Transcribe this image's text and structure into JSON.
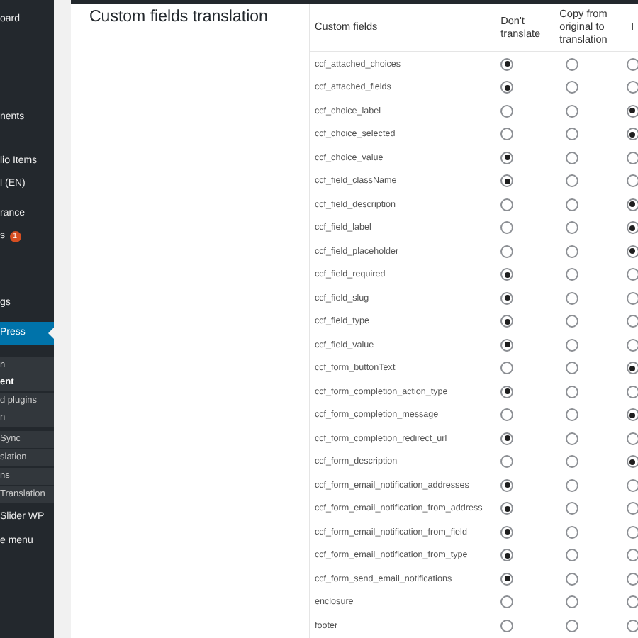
{
  "sidebar": {
    "items": [
      {
        "label": "oard",
        "kind": "item"
      },
      {
        "label": "nents",
        "kind": "item"
      },
      {
        "label": "lio Items",
        "kind": "item"
      },
      {
        "label": "l (EN)",
        "kind": "item"
      },
      {
        "label": "rance",
        "kind": "item"
      },
      {
        "label": "s",
        "kind": "item",
        "badge": "1"
      },
      {
        "label": "gs",
        "kind": "item"
      },
      {
        "label": "Press",
        "kind": "current"
      },
      {
        "label": "n",
        "kind": "sub"
      },
      {
        "label": "ent",
        "kind": "sub-current"
      },
      {
        "label": "d plugins",
        "kind": "sub"
      },
      {
        "label": "n",
        "kind": "sub"
      },
      {
        "label": "Sync",
        "kind": "sub"
      },
      {
        "label": "slation",
        "kind": "sub"
      },
      {
        "label": "ns",
        "kind": "sub"
      },
      {
        "label": "Translation",
        "kind": "sub"
      },
      {
        "label": "Slider WP",
        "kind": "item"
      },
      {
        "label": "e menu",
        "kind": "item"
      }
    ]
  },
  "section_title": "Custom fields translation",
  "table": {
    "columns": [
      "Custom fields",
      "Don't translate",
      "Copy from original to translation",
      "T"
    ],
    "rows": [
      {
        "name": "ccf_attached_choices",
        "options": [
          {
            "selected": true
          },
          {
            "selected": false
          },
          {
            "selected": false
          }
        ]
      },
      {
        "name": "ccf_attached_fields",
        "options": [
          {
            "selected": true
          },
          {
            "selected": false
          },
          {
            "selected": false
          }
        ]
      },
      {
        "name": "ccf_choice_label",
        "options": [
          {
            "selected": false
          },
          {
            "selected": false
          },
          {
            "selected": true
          }
        ]
      },
      {
        "name": "ccf_choice_selected",
        "options": [
          {
            "selected": false
          },
          {
            "selected": false
          },
          {
            "selected": true
          }
        ]
      },
      {
        "name": "ccf_choice_value",
        "options": [
          {
            "selected": true
          },
          {
            "selected": false
          },
          {
            "selected": false
          }
        ]
      },
      {
        "name": "ccf_field_className",
        "options": [
          {
            "selected": true
          },
          {
            "selected": false
          },
          {
            "selected": false
          }
        ]
      },
      {
        "name": "ccf_field_description",
        "options": [
          {
            "selected": false
          },
          {
            "selected": false
          },
          {
            "selected": true
          }
        ]
      },
      {
        "name": "ccf_field_label",
        "options": [
          {
            "selected": false
          },
          {
            "selected": false
          },
          {
            "selected": true
          }
        ]
      },
      {
        "name": "ccf_field_placeholder",
        "options": [
          {
            "selected": false
          },
          {
            "selected": false
          },
          {
            "selected": true
          }
        ]
      },
      {
        "name": "ccf_field_required",
        "options": [
          {
            "selected": true
          },
          {
            "selected": false
          },
          {
            "selected": false
          }
        ]
      },
      {
        "name": "ccf_field_slug",
        "options": [
          {
            "selected": true
          },
          {
            "selected": false
          },
          {
            "selected": false
          }
        ]
      },
      {
        "name": "ccf_field_type",
        "options": [
          {
            "selected": true
          },
          {
            "selected": false
          },
          {
            "selected": false
          }
        ]
      },
      {
        "name": "ccf_field_value",
        "options": [
          {
            "selected": true
          },
          {
            "selected": false
          },
          {
            "selected": false
          }
        ]
      },
      {
        "name": "ccf_form_buttonText",
        "options": [
          {
            "selected": false
          },
          {
            "selected": false
          },
          {
            "selected": true
          }
        ]
      },
      {
        "name": "ccf_form_completion_action_type",
        "options": [
          {
            "selected": true
          },
          {
            "selected": false
          },
          {
            "selected": false
          }
        ]
      },
      {
        "name": "ccf_form_completion_message",
        "options": [
          {
            "selected": false
          },
          {
            "selected": false
          },
          {
            "selected": true
          }
        ]
      },
      {
        "name": "ccf_form_completion_redirect_url",
        "options": [
          {
            "selected": true
          },
          {
            "selected": false
          },
          {
            "selected": false
          }
        ]
      },
      {
        "name": "ccf_form_description",
        "options": [
          {
            "selected": false
          },
          {
            "selected": false
          },
          {
            "selected": true
          }
        ]
      },
      {
        "name": "ccf_form_email_notification_addresses",
        "options": [
          {
            "selected": true
          },
          {
            "selected": false
          },
          {
            "selected": false
          }
        ]
      },
      {
        "name": "ccf_form_email_notification_from_address",
        "options": [
          {
            "selected": true
          },
          {
            "selected": false
          },
          {
            "selected": false
          }
        ]
      },
      {
        "name": "ccf_form_email_notification_from_field",
        "options": [
          {
            "selected": true
          },
          {
            "selected": false
          },
          {
            "selected": false
          }
        ]
      },
      {
        "name": "ccf_form_email_notification_from_type",
        "options": [
          {
            "selected": true
          },
          {
            "selected": false
          },
          {
            "selected": false
          }
        ]
      },
      {
        "name": "ccf_form_send_email_notifications",
        "options": [
          {
            "selected": true
          },
          {
            "selected": false
          },
          {
            "selected": false
          }
        ]
      },
      {
        "name": "enclosure",
        "options": [
          {
            "selected": false
          },
          {
            "selected": false
          },
          {
            "selected": false
          }
        ]
      },
      {
        "name": "footer",
        "options": [
          {
            "selected": false
          },
          {
            "selected": false
          },
          {
            "selected": false
          }
        ]
      }
    ]
  }
}
